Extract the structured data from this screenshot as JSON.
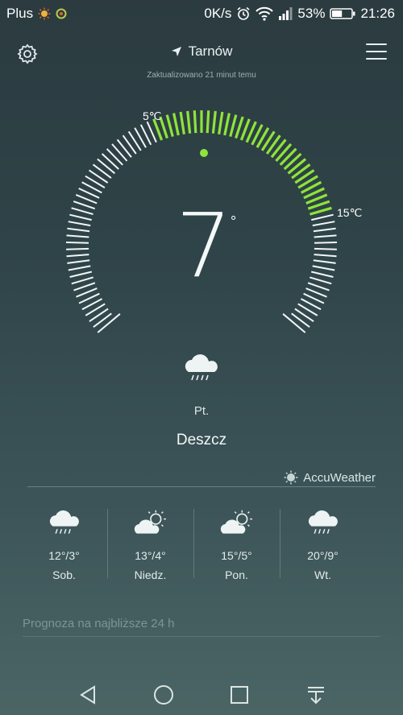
{
  "status_bar": {
    "carrier": "Plus",
    "network_speed": "0K/s",
    "battery_percent": "53%",
    "time": "21:26",
    "battery_level": 0.53
  },
  "header": {
    "location": "Tarnów",
    "updated": "Zaktualizowano 21 minut temu"
  },
  "dial": {
    "min_label": "5℃",
    "max_label": "15℃",
    "current_temp": "7",
    "unit": "°",
    "accent_color": "#8ee43a"
  },
  "current": {
    "day": "Pt.",
    "condition": "Deszcz",
    "icon": "cloud-rain-icon"
  },
  "provider": "AccuWeather",
  "forecast": [
    {
      "range": "12°/3°",
      "day": "Sob.",
      "icon": "cloud-rain-icon"
    },
    {
      "range": "13°/4°",
      "day": "Niedz.",
      "icon": "sun-cloud-icon"
    },
    {
      "range": "15°/5°",
      "day": "Pon.",
      "icon": "sun-cloud-icon"
    },
    {
      "range": "20°/9°",
      "day": "Wt.",
      "icon": "cloud-rain-icon"
    }
  ],
  "hourly_label": "Prognoza na najbliższe 24 h"
}
